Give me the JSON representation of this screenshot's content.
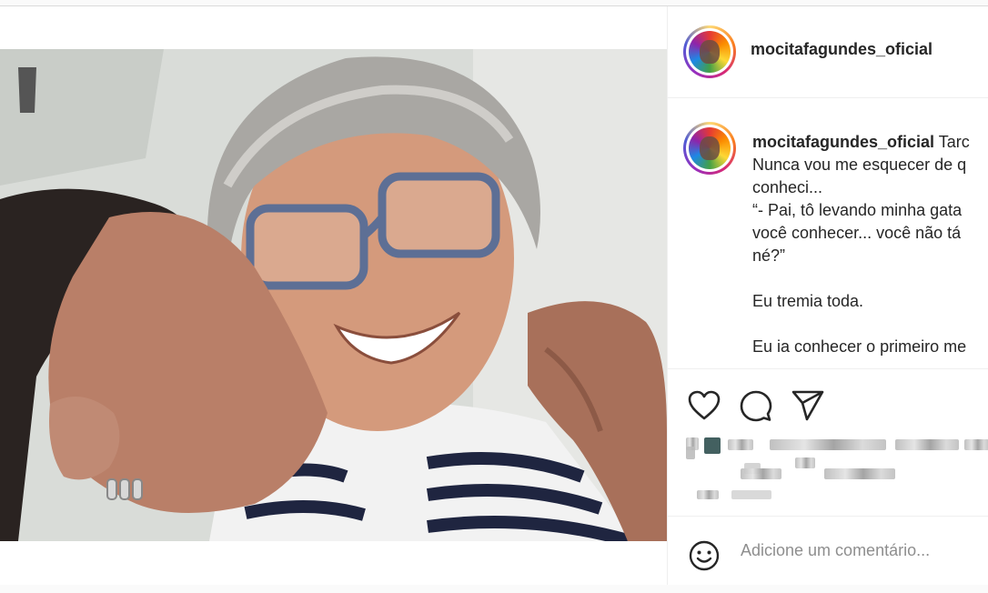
{
  "post": {
    "username": "mocitafagundes_oficial",
    "caption_user": "mocitafagundes_oficial",
    "caption_text": " Tarc\nNunca vou me esquecer de q\nconheci...\n“- Pai, tô levando minha gata\nvocê conhecer... você não tá\nné?”\n\nEu tremia toda.\n\nEu ia conhecer o primeiro me"
  },
  "actions": {
    "like_icon": "heart-icon",
    "comment_icon": "comment-bubble-icon",
    "share_icon": "paper-plane-icon"
  },
  "comment_box": {
    "emoji_icon": "smiley-icon",
    "placeholder": "Adicione um comentário..."
  },
  "colors": {
    "story_ring": [
      "#feda75",
      "#fa7e1e",
      "#d62976",
      "#962fbf",
      "#4f5bd5"
    ],
    "text": "#262626",
    "muted": "#8e8e8e"
  }
}
